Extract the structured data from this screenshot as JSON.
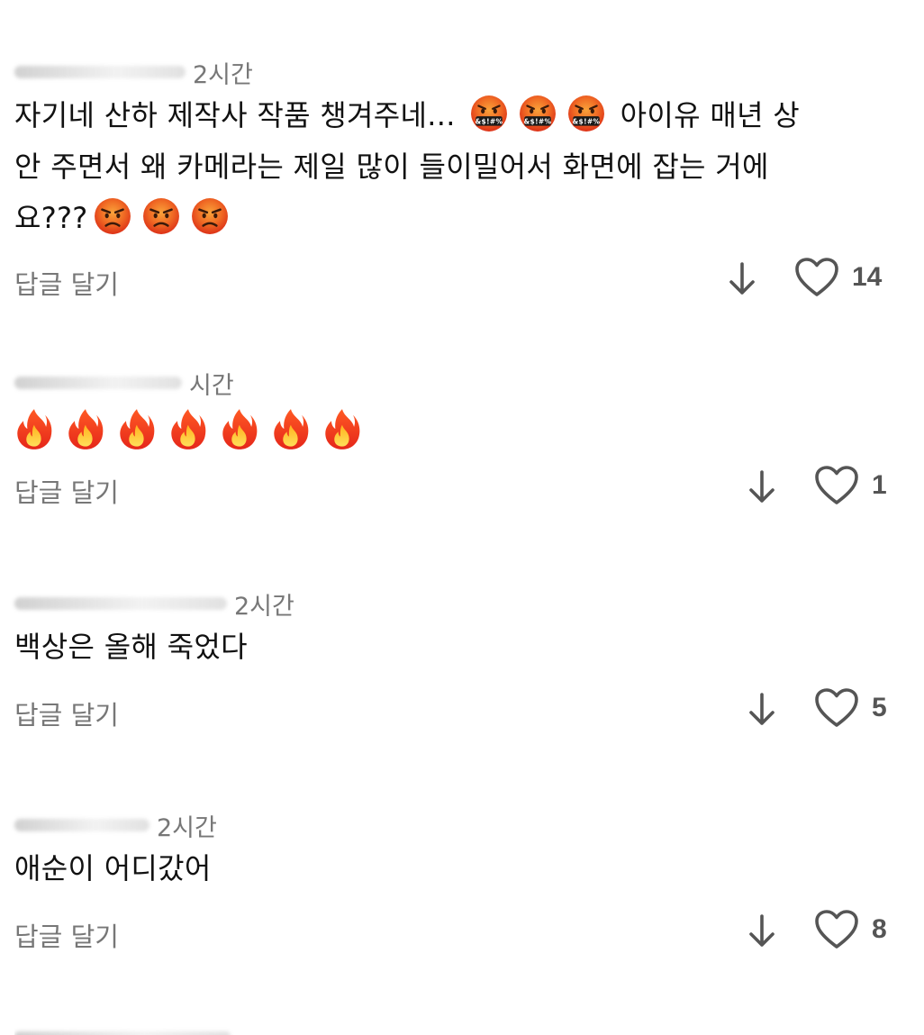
{
  "comments": [
    {
      "time": "2시간",
      "text_line1": "자기네 산하 제작사 작품 챙겨주네...",
      "text_line1_tail": "아이유 매년 상",
      "text_line2": "안 주면서 왜 카메라는 제일 많이 들이밀어서 화면에 잡는 거에",
      "text_line3": "요???",
      "reply_label": "답글 달기",
      "like_count": "14",
      "icons": [
        "cursing-face-emoji",
        "angry-face-emoji"
      ]
    },
    {
      "time": "시간",
      "reply_label": "답글 달기",
      "like_count": "1",
      "icons": [
        "fire-emoji"
      ],
      "fire_count": 7
    },
    {
      "time": "2시간",
      "text": "백상은 올해 죽었다",
      "reply_label": "답글 달기",
      "like_count": "5"
    },
    {
      "time": "2시간",
      "text": "애순이 어디갔어",
      "reply_label": "답글 달기",
      "like_count": "8"
    }
  ],
  "colors": {
    "text": "#111111",
    "muted": "#777777",
    "icon": "#555555",
    "emoji_red": "#e8441c",
    "emoji_orange": "#f7931e",
    "fire_red": "#f0301a",
    "fire_yellow": "#ffc93a"
  }
}
